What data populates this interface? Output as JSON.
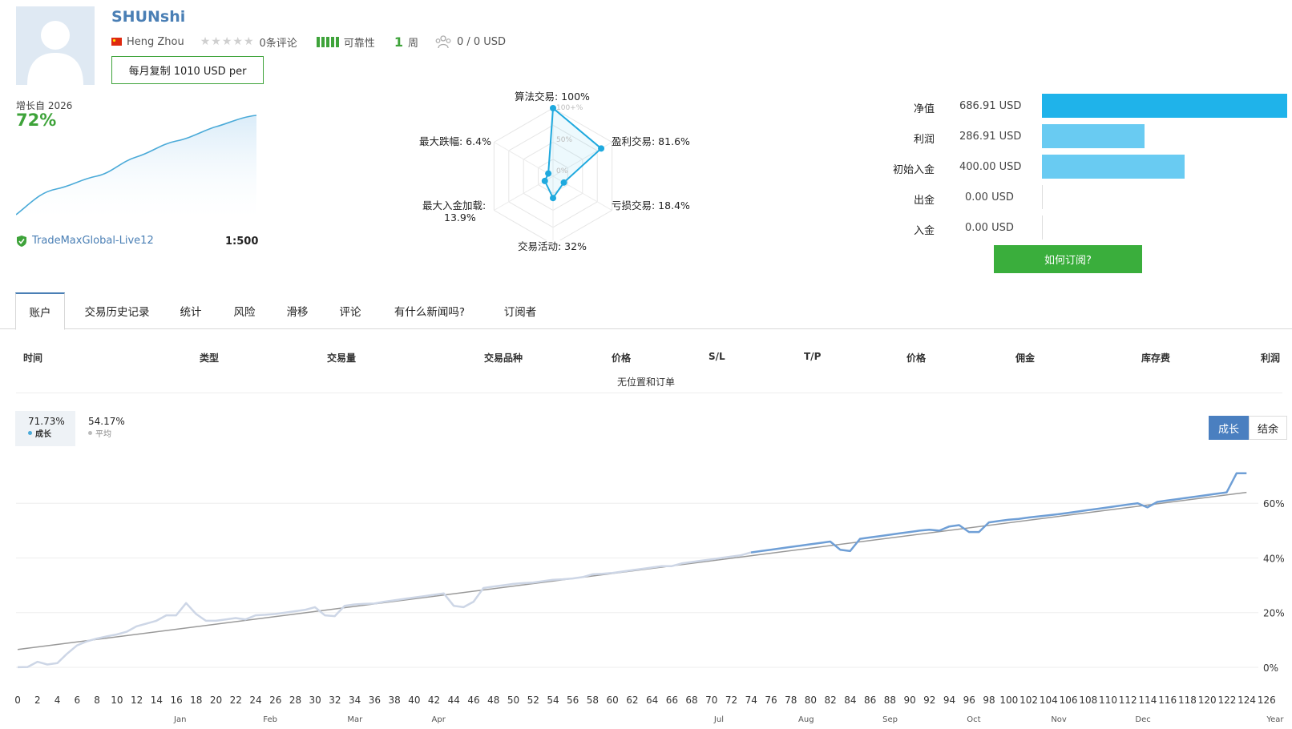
{
  "header": {
    "username": "SHUNshi",
    "location": "Heng Zhou",
    "rating_stars": 0,
    "reviews": "0条评论",
    "reliability_label": "可靠性",
    "weeks_num": "1",
    "weeks_unit": "周",
    "subscribers": "0 / 0 USD",
    "copy_button": "每月复制 1010 USD per"
  },
  "summary": {
    "growth_label": "增长自 2026",
    "growth_value": "72%",
    "server": "TradeMaxGlobal-Live12",
    "leverage": "1:500"
  },
  "radar": {
    "algo": "算法交易: 100%",
    "profit_trades": "盈利交易: 81.6%",
    "loss_trades": "亏损交易: 18.4%",
    "activity": "交易活动: 32%",
    "max_deposit_load_1": "最大入金加载:",
    "max_deposit_load_2": "13.9%",
    "max_drawdown": "最大跌幅: 6.4%",
    "ring_100": "100+%",
    "ring_50": "50%",
    "ring_0": "0%",
    "values": [
      1.0,
      0.816,
      0.184,
      0.32,
      0.139,
      0.064
    ]
  },
  "stats": [
    {
      "label": "净值",
      "value": "686.91 USD",
      "fraction": 1.0,
      "color": "#1fb3ea"
    },
    {
      "label": "利润",
      "value": "286.91 USD",
      "fraction": 0.418,
      "color": "#69cbf2"
    },
    {
      "label": "初始入金",
      "value": "400.00 USD",
      "fraction": 0.582,
      "color": "#69cbf2"
    },
    {
      "label": "出金",
      "value": "0.00 USD",
      "fraction": 0,
      "color": "#69cbf2"
    },
    {
      "label": "入金",
      "value": "0.00 USD",
      "fraction": 0,
      "color": "#69cbf2"
    }
  ],
  "subscribe_button": "如何订阅?",
  "tabs": [
    "账户",
    "交易历史记录",
    "统计",
    "风险",
    "滑移",
    "评论",
    "有什么新闻吗?",
    "订阅者"
  ],
  "table": {
    "headers": [
      "时间",
      "类型",
      "交易量",
      "交易品种",
      "价格",
      "S/L",
      "T/P",
      "价格",
      "佣金",
      "库存费",
      "利润"
    ],
    "empty_message": "无位置和订单"
  },
  "chart_legend": {
    "growth_value": "71.73%",
    "growth_label": "成长",
    "avg_value": "54.17%",
    "avg_label": "平均"
  },
  "chart_toggle": {
    "growth": "成长",
    "balance": "结余"
  },
  "chart_data": {
    "type": "line",
    "ylim": [
      -5,
      80
    ],
    "xlim": [
      0,
      126
    ],
    "y_ticks": [
      "0%",
      "20%",
      "40%",
      "60%"
    ],
    "x_ticks": [
      "0",
      "2",
      "4",
      "6",
      "8",
      "10",
      "12",
      "14",
      "16",
      "18",
      "20",
      "22",
      "24",
      "26",
      "28",
      "30",
      "32",
      "34",
      "36",
      "38",
      "40",
      "42",
      "44",
      "46",
      "48",
      "50",
      "52",
      "54",
      "56",
      "58",
      "60",
      "62",
      "64",
      "66",
      "68",
      "70",
      "72",
      "74",
      "76",
      "78",
      "80",
      "82",
      "84",
      "86",
      "88",
      "90",
      "92",
      "94",
      "96",
      "98",
      "100",
      "102",
      "104",
      "106",
      "108",
      "110",
      "112",
      "114",
      "116",
      "118",
      "120",
      "122",
      "124",
      "126"
    ],
    "months": [
      "Jan",
      "Feb",
      "Mar",
      "Apr",
      "Jul",
      "Aug",
      "Sep",
      "Oct",
      "Nov",
      "Dec",
      "Year"
    ],
    "series": [
      {
        "color": "#6f9fd6",
        "x": [
          0,
          1,
          2,
          3,
          4,
          5,
          6,
          7,
          8,
          9,
          10,
          11,
          12,
          13,
          14,
          15,
          16,
          17,
          18,
          19,
          20,
          21,
          22,
          23,
          24,
          25,
          26,
          27,
          28,
          29,
          30,
          31,
          32,
          33,
          34,
          35,
          36,
          37,
          38,
          39,
          40,
          41,
          42,
          43,
          44,
          45,
          46,
          47,
          48,
          49,
          50,
          51,
          52,
          53,
          54,
          55,
          56,
          57,
          58,
          59,
          60,
          61,
          62,
          63,
          64,
          65,
          66,
          67,
          68,
          69,
          70,
          71,
          72,
          73,
          74,
          75,
          76,
          77,
          78,
          79,
          80,
          81,
          82,
          83,
          84,
          85,
          86,
          87,
          88,
          89,
          90,
          91,
          92,
          93,
          94,
          95,
          96,
          97,
          98,
          99,
          100,
          101,
          102,
          103,
          104,
          105,
          106,
          107,
          108,
          109,
          110,
          111,
          112,
          113,
          114,
          115,
          116,
          117,
          118,
          119,
          120,
          121,
          122,
          123,
          124
        ],
        "y": [
          0,
          0.1,
          2,
          1,
          1.5,
          5,
          8,
          9.5,
          10.5,
          11.3,
          12,
          13,
          15,
          16,
          17,
          19,
          19,
          23.5,
          19.5,
          17,
          17,
          17.5,
          18,
          17.5,
          19,
          19.2,
          19.5,
          20,
          20.5,
          21,
          22,
          19,
          18.7,
          22.5,
          23,
          23.2,
          23.3,
          24,
          24.5,
          25,
          25.5,
          26,
          26.5,
          27,
          22.5,
          22,
          24,
          29,
          29.5,
          30,
          30.5,
          30.8,
          31,
          31.5,
          32,
          32.2,
          32.5,
          33,
          34,
          34.2,
          34.5,
          35,
          35.5,
          36,
          36.5,
          37,
          37,
          38,
          38.5,
          39,
          39.5,
          40,
          40.5,
          41,
          42,
          42.5,
          43,
          43.5,
          44,
          44.5,
          45,
          45.5,
          46,
          43,
          42.5,
          47,
          47.5,
          48,
          48.5,
          49,
          49.5,
          50,
          50.3,
          50,
          51.5,
          52,
          49.5,
          49.5,
          53,
          53.5,
          54,
          54.3,
          54.8,
          55.2,
          55.6,
          56,
          56.5,
          57,
          57.5,
          58,
          58.5,
          59,
          59.5,
          60,
          58.5,
          60.5,
          61,
          61.5,
          62,
          62.5,
          63,
          63.5,
          64,
          71,
          71
        ]
      },
      {
        "color": "#999999",
        "x": [
          0,
          124
        ],
        "y": [
          6.5,
          64
        ]
      }
    ]
  }
}
